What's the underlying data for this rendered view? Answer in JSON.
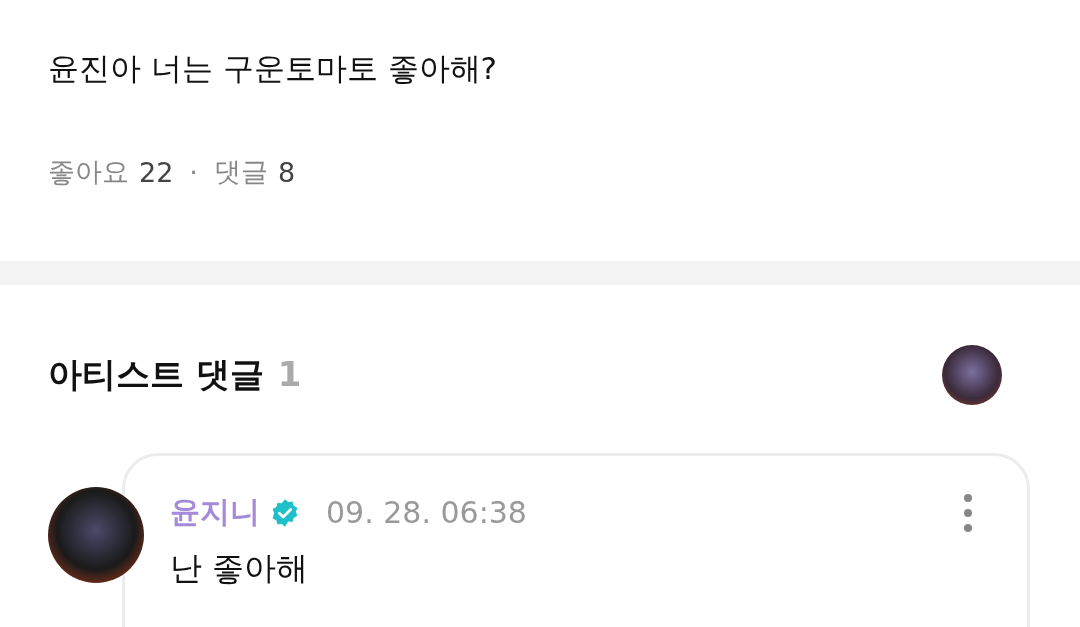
{
  "post": {
    "text": "윤진아 너는 구운토마토 좋아해?",
    "like_label": "좋아요",
    "like_count": "22",
    "separator": "·",
    "comment_label": "댓글",
    "comment_count": "8"
  },
  "artist_comments": {
    "title": "아티스트 댓글",
    "count": "1"
  },
  "comments": [
    {
      "author": "윤지니",
      "verified": true,
      "time": "09. 28. 06:38",
      "text": "난 좋아해"
    }
  ]
}
